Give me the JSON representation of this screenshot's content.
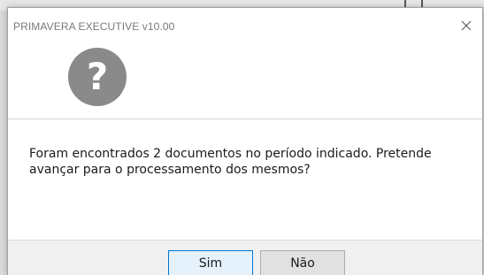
{
  "dialog": {
    "title": "PRIMAVERA EXECUTIVE v10.00",
    "icon": "question-icon",
    "icon_glyph": "?",
    "message": "Foram encontrados 2 documentos no período indicado. Pretende avançar para o processamento dos mesmos?",
    "buttons": {
      "yes_label": "Sim",
      "no_label": "Não"
    }
  },
  "colors": {
    "icon_fill": "#8a8a8a",
    "default_button_border": "#0078d7",
    "button_bar": "#f0f0f0"
  }
}
